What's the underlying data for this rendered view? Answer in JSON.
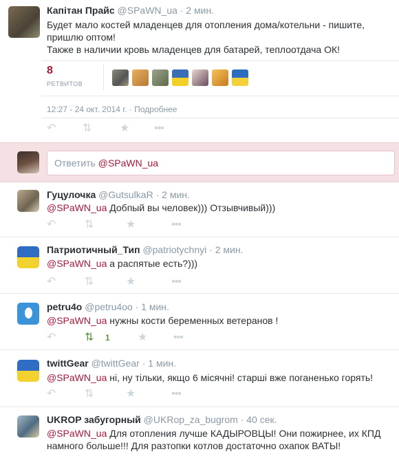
{
  "main_tweet": {
    "name": "Капітан Прайс",
    "handle": "@SPaWN_ua",
    "time": "2 мин.",
    "text_lines": [
      "Будет мало костей младенцев для отопления дома/котельни - пишите,",
      "пришлю оптом!",
      "Также в наличии кровь младенцев для батарей, теплоотдача ОК!"
    ],
    "retweet_count": "8",
    "retweet_label": "РЕТВИТОВ",
    "date": "12:27 - 24 окт. 2014 г.",
    "details_link": "Подробнее"
  },
  "reply_box": {
    "prefix": "Ответить",
    "mention": "@SPaWN_ua"
  },
  "replies": [
    {
      "name": "Гуцулочка",
      "handle": "@GutsulkaR",
      "time": "2 мин.",
      "mention": "@SPaWN_ua",
      "text_lines": [
        " Добпый вы человек))) Отзывчивый)))"
      ],
      "retweet_count": ""
    },
    {
      "name": "Патриотичный_Тип",
      "handle": "@patriotychnyi",
      "time": "2 мин.",
      "mention": "@SPaWN_ua",
      "text_lines": [
        " а распятые есть?)))"
      ],
      "retweet_count": ""
    },
    {
      "name": "petru4o",
      "handle": "@petru4oo",
      "time": "1 мин.",
      "mention": "@SPaWN_ua",
      "text_lines": [
        " нужны кости беременных ветеранов !"
      ],
      "retweet_count": "1"
    },
    {
      "name": "twittGear",
      "handle": "@twittGear",
      "time": "1 мин.",
      "mention": "@SPaWN_ua",
      "text_lines": [
        " ні, ну тільки, якщо 6 місячні! старші вже поганенько горять!"
      ],
      "retweet_count": ""
    },
    {
      "name": "UKROP забугорный",
      "handle": "@UKRop_za_bugrom",
      "time": "40 сек.",
      "mention": "@SPaWN_ua",
      "text_lines": [
        " Для отопления лучше КАДЫРОВЦЫ! Они пожирнее, их КПД",
        "намного больше!!! Для разтопки котлов достаточно охапок ВАТЫ!"
      ],
      "retweet_count": ""
    }
  ],
  "separator": "·",
  "icons": {
    "reply": "reply-icon",
    "retweet": "retweet-icon",
    "favorite": "star-icon",
    "more": "more-icon"
  },
  "colors": {
    "accent": "#a7173a",
    "retweet_active": "#5c913b",
    "muted": "#8899a6"
  }
}
